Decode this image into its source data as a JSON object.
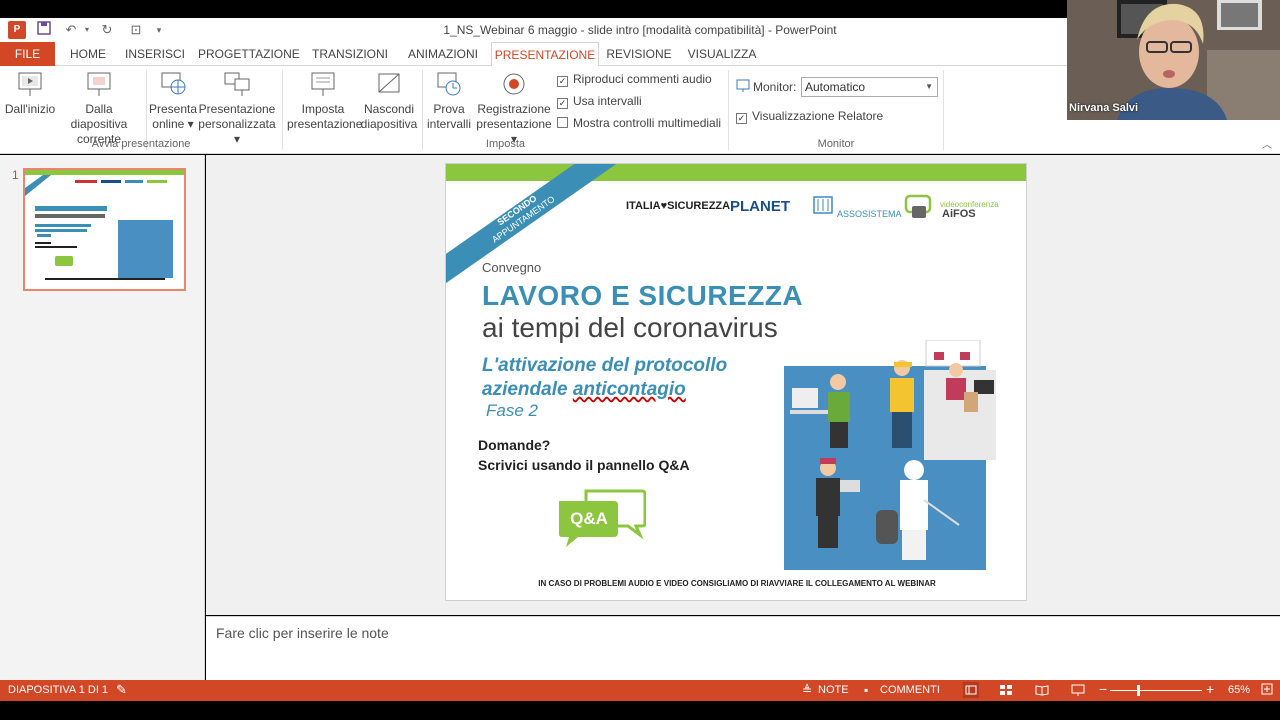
{
  "window": {
    "title": "1_NS_Webinar 6 maggio - slide intro [modalità compatibilità] - PowerPoint",
    "app_icon": "P"
  },
  "tabs": [
    "FILE",
    "HOME",
    "INSERISCI",
    "PROGETTAZIONE",
    "TRANSIZIONI",
    "ANIMAZIONI",
    "PRESENTAZIONE",
    "REVISIONE",
    "VISUALIZZA"
  ],
  "active_tab": "PRESENTAZIONE",
  "ribbon": {
    "groups": {
      "avvia": "Avvia presentazione",
      "imposta": "Imposta",
      "monitor": "Monitor"
    },
    "buttons": {
      "dall_inizio": "Dall'inizio",
      "dalla_diapositiva_1": "Dalla diapositiva",
      "dalla_diapositiva_2": "corrente",
      "presenta_online_1": "Presenta",
      "presenta_online_2": "online ▾",
      "personalizzata_1": "Presentazione",
      "personalizzata_2": "personalizzata ▾",
      "imposta_1": "Imposta",
      "imposta_2": "presentazione",
      "nascondi_1": "Nascondi",
      "nascondi_2": "diapositiva",
      "prova_1": "Prova",
      "prova_2": "intervalli",
      "registrazione_1": "Registrazione",
      "registrazione_2": "presentazione ▾"
    },
    "checkboxes": {
      "commenti_audio": "Riproduci commenti audio",
      "intervalli": "Usa intervalli",
      "controlli": "Mostra controlli multimediali",
      "relatore": "Visualizzazione Relatore"
    },
    "monitor_label": "Monitor:",
    "monitor_value": "Automatico"
  },
  "thumbnail": {
    "number": "1"
  },
  "slide": {
    "badge_line1": "SECONDO",
    "badge_line2": "APPUNTAMENTO",
    "logo1": "ITALIA♥SICUREZZA",
    "logo2": "PLANET",
    "logo3": "ASSOSISTEMA",
    "logo4": "AiFOS",
    "logo4_small": "videoconferenza",
    "convegno": "Convegno",
    "title1": "LAVORO E SICUREZZA",
    "title2": "ai tempi del coronavirus",
    "sub1": "L'attivazione del protocollo",
    "sub2a": "aziendale ",
    "sub2b": "anticontagio",
    "fase": "Fase 2",
    "q1": "Domande?",
    "q2": "Scrivici usando il pannello Q&A",
    "qa_label": "Q&A",
    "footer": "IN CASO DI PROBLEMI AUDIO E VIDEO CONSIGLIAMO DI RIAVVIARE IL COLLEGAMENTO AL WEBINAR"
  },
  "notes_placeholder": "Fare clic per inserire le note",
  "status": {
    "slide_counter": "DIAPOSITIVA 1 DI 1",
    "note": "NOTE",
    "commenti": "COMMENTI",
    "zoom": "65%"
  },
  "webcam": {
    "name": "Nirvana Salvi"
  },
  "colors": {
    "accent": "#d24726",
    "slide_blue": "#3b8eb5",
    "slide_green": "#8cc63f"
  }
}
